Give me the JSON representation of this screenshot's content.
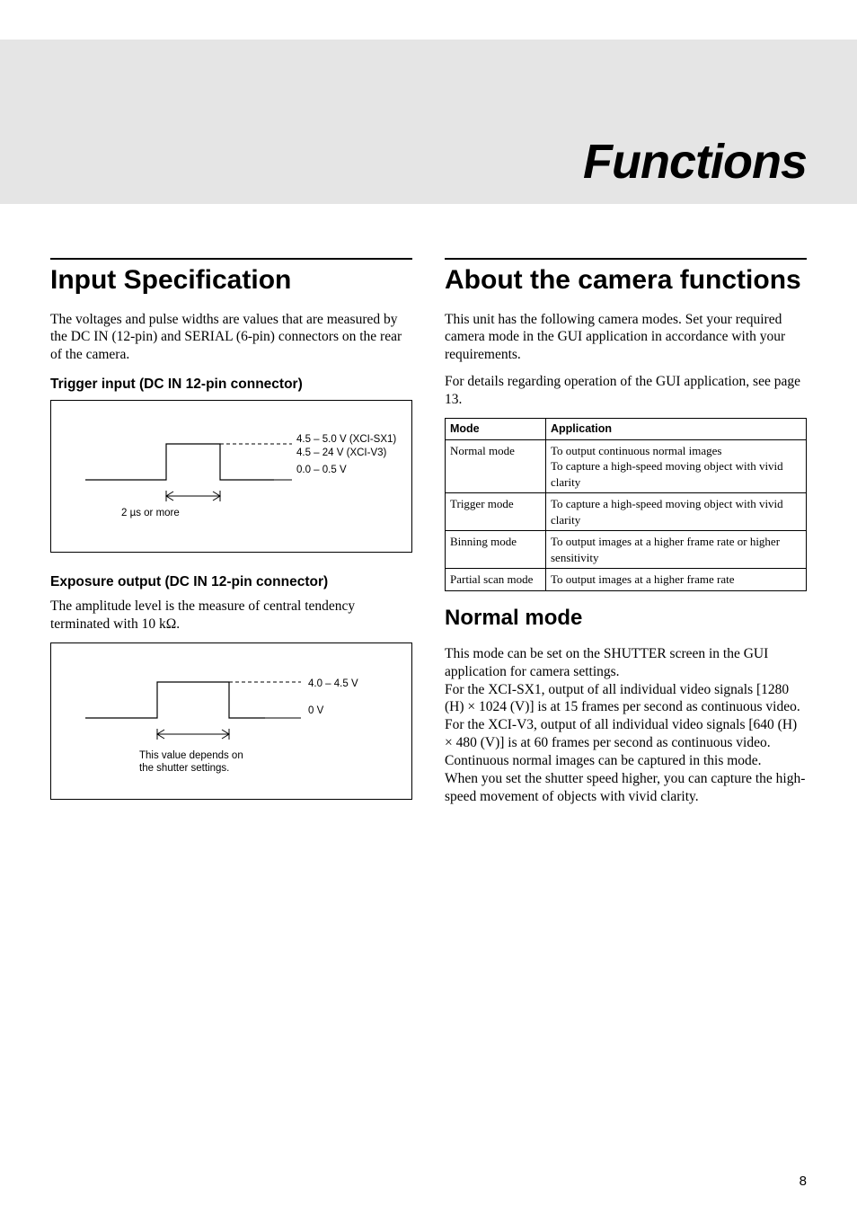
{
  "chapter": {
    "title": "Functions"
  },
  "left": {
    "heading": "Input Specification",
    "intro": "The voltages and pulse widths are values that are measured by the DC IN (12-pin) and SERIAL (6-pin) connectors on the rear of the camera.",
    "trigger": {
      "heading": "Trigger input (DC IN 12-pin connector)",
      "high1": "4.5 – 5.0 V (XCI-SX1)",
      "high2": "4.5 – 24 V (XCI-V3)",
      "low": "0.0 – 0.5 V",
      "width": "2 µs or more"
    },
    "exposure": {
      "heading": "Exposure output (DC IN 12-pin connector)",
      "desc": "The amplitude level is the measure of central tendency terminated with 10 kΩ.",
      "high": "4.0 – 4.5 V",
      "low": "0 V",
      "note1": "This value depends on",
      "note2": "the shutter settings."
    }
  },
  "right": {
    "heading": "About the camera functions",
    "p1": "This unit has the following camera modes.  Set your required camera mode in the GUI application in accordance with your requirements.",
    "p2": "For details regarding operation of the GUI application, see page 13.",
    "table": {
      "hmode": "Mode",
      "happ": "Application",
      "rows": [
        {
          "mode": "Normal mode",
          "app": "To output continuous normal images\nTo capture a high-speed moving object with vivid clarity"
        },
        {
          "mode": "Trigger mode",
          "app": "To capture a high-speed moving object with vivid clarity"
        },
        {
          "mode": "Binning mode",
          "app": "To output images at a higher frame rate or higher sensitivity"
        },
        {
          "mode": "Partial scan mode",
          "app": "To output images at a higher frame rate"
        }
      ]
    },
    "normal": {
      "heading": "Normal mode",
      "p1": "This mode can be set on the SHUTTER screen in the GUI application for camera settings.",
      "p2": "For the XCI-SX1, output of all individual video signals [1280 (H) × 1024 (V)] is at 15 frames per second as continuous video.",
      "p3": "For the XCI-V3, output of all individual video signals [640 (H) × 480 (V)] is at 60 frames per second as continuous video.",
      "p4": "Continuous normal images can be captured in this mode.",
      "p5": "When you set the shutter speed higher, you can capture the high-speed movement of objects with vivid clarity."
    }
  },
  "page": "8"
}
